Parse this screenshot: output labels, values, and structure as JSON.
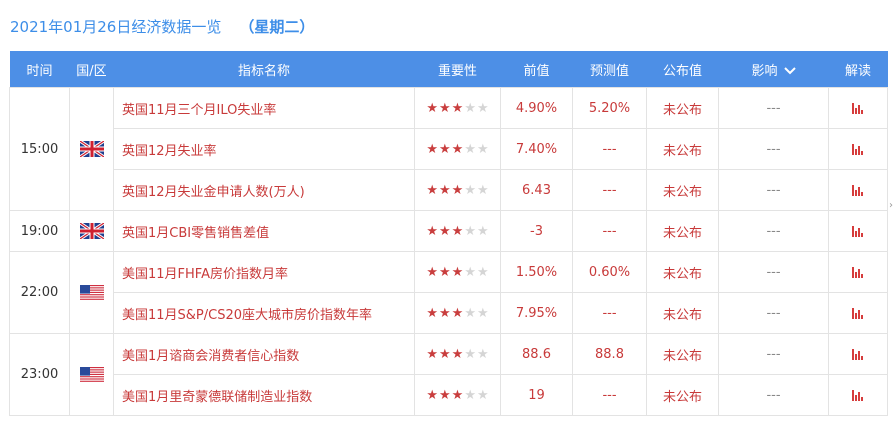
{
  "title": {
    "date_text": "2021年01月26日经济数据一览",
    "weekday_text": "（星期二）"
  },
  "headers": {
    "time": "时间",
    "country": "国/区",
    "indicator": "指标名称",
    "importance": "重要性",
    "previous": "前值",
    "forecast": "预测值",
    "actual": "公布值",
    "impact": "影响",
    "analysis": "解读"
  },
  "colors": {
    "header_bg": "#4d8fe6",
    "accent_red": "#c83a3a",
    "title_blue": "#3d8ee8"
  },
  "rows": [
    {
      "time": "15:00",
      "country_icon": "uk-flag-icon",
      "indicator": "英国11月三个月ILO失业率",
      "stars": 3,
      "previous": "4.90%",
      "forecast": "5.20%",
      "actual": "未公布",
      "impact": "---"
    },
    {
      "time": "15:00",
      "country_icon": "uk-flag-icon",
      "indicator": "英国12月失业率",
      "stars": 3,
      "previous": "7.40%",
      "forecast": "---",
      "actual": "未公布",
      "impact": "---"
    },
    {
      "time": "15:00",
      "country_icon": "uk-flag-icon",
      "indicator": "英国12月失业金申请人数(万人)",
      "stars": 3,
      "previous": "6.43",
      "forecast": "---",
      "actual": "未公布",
      "impact": "---"
    },
    {
      "time": "19:00",
      "country_icon": "uk-flag-icon",
      "indicator": "英国1月CBI零售销售差值",
      "stars": 3,
      "previous": "-3",
      "forecast": "---",
      "actual": "未公布",
      "impact": "---"
    },
    {
      "time": "22:00",
      "country_icon": "us-flag-icon",
      "indicator": "美国11月FHFA房价指数月率",
      "stars": 3,
      "previous": "1.50%",
      "forecast": "0.60%",
      "actual": "未公布",
      "impact": "---"
    },
    {
      "time": "22:00",
      "country_icon": "us-flag-icon",
      "indicator": "美国11月S&P/CS20座大城市房价指数年率",
      "stars": 3,
      "previous": "7.95%",
      "forecast": "---",
      "actual": "未公布",
      "impact": "---"
    },
    {
      "time": "23:00",
      "country_icon": "us-flag-icon",
      "indicator": "美国1月谘商会消费者信心指数",
      "stars": 3,
      "previous": "88.6",
      "forecast": "88.8",
      "actual": "未公布",
      "impact": "---"
    },
    {
      "time": "23:00",
      "country_icon": "us-flag-icon",
      "indicator": "美国1月里奇蒙德联储制造业指数",
      "stars": 3,
      "previous": "19",
      "forecast": "---",
      "actual": "未公布",
      "impact": "---"
    }
  ],
  "max_stars": 5
}
